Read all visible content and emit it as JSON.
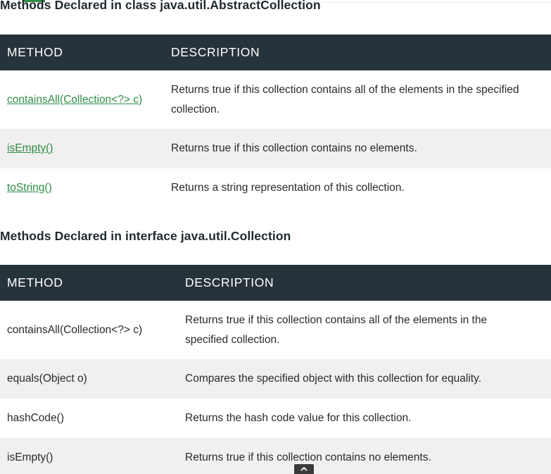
{
  "section1": {
    "heading": "Methods Declared in class java.util.AbstractCollection",
    "columns": [
      "METHOD",
      "DESCRIPTION"
    ],
    "rows": [
      {
        "method": "containsAll(Collection<?> c)",
        "description": "Returns true if this collection contains all of the elements in the specified collection."
      },
      {
        "method": "isEmpty()",
        "description": "Returns true if this collection contains no elements."
      },
      {
        "method": "toString()",
        "description": "Returns a string representation of this collection."
      }
    ]
  },
  "section2": {
    "heading": "Methods Declared in interface java.util.Collection",
    "columns": [
      "METHOD",
      "DESCRIPTION"
    ],
    "rows": [
      {
        "method": "containsAll(Collection<?> c)",
        "description": "Returns true if this collection contains all of the elements in the specified collection."
      },
      {
        "method": "equals(Object o)",
        "description": "Compares the specified object with this collection for equality."
      },
      {
        "method": "hashCode()",
        "description": "Returns the hash code value for this collection."
      },
      {
        "method": "isEmpty()",
        "description": "Returns true if this collection contains no elements."
      }
    ]
  },
  "colors": {
    "header_bg": "#27333a",
    "link": "#2f8d46",
    "stripe": "#f0f0f0"
  },
  "icons": {
    "scroll_to_top": "chevron-up-icon"
  }
}
